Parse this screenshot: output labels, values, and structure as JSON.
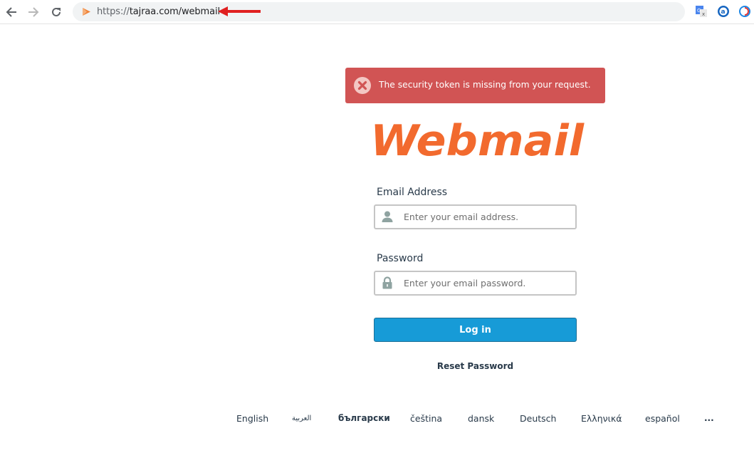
{
  "browser": {
    "url_scheme": "https://",
    "url_rest": "tajraa.com/webmail",
    "back_icon": "arrow-left-icon",
    "forward_icon": "arrow-right-icon",
    "reload_icon": "reload-icon",
    "extensions": [
      "google-translate-icon",
      "amazon-assistant-icon",
      "sync-extension-icon"
    ]
  },
  "alert": {
    "message": "The security token is missing from your request.",
    "icon": "error-x-icon",
    "color": "#d15454"
  },
  "logo": {
    "text": "Webmail",
    "color": "#f26a2e"
  },
  "form": {
    "email_label": "Email Address",
    "email_placeholder": "Enter your email address.",
    "email_value": "",
    "password_label": "Password",
    "password_placeholder": "Enter your email password.",
    "password_value": "",
    "login_label": "Log in",
    "reset_label": "Reset Password",
    "accent_color": "#179bd7"
  },
  "languages": [
    "English",
    "العربية",
    "български",
    "čeština",
    "dansk",
    "Deutsch",
    "Ελληνικά",
    "español",
    "..."
  ]
}
